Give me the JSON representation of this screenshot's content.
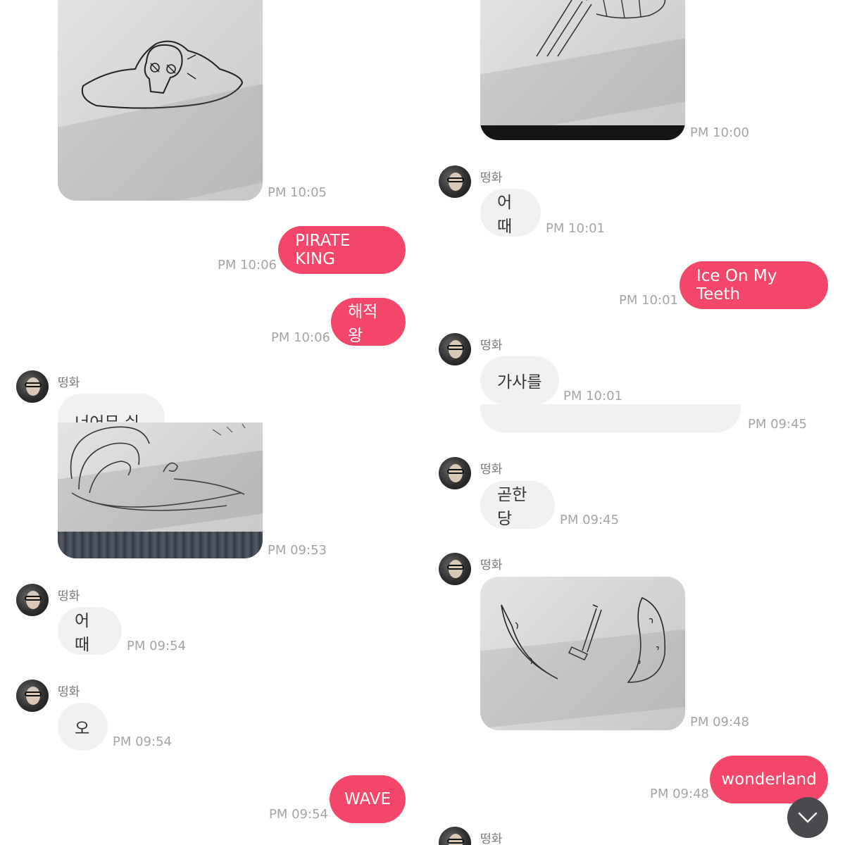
{
  "contact_name": "떵화",
  "colors": {
    "outgoing_bubble": "#f4456a",
    "incoming_bubble": "#f1f1f3",
    "timestamp": "#a5a5a5"
  },
  "left": {
    "photo_pirate_time": "PM 10:05",
    "out_pirate_king": {
      "text": "PIRATE KING",
      "time": "PM 10:06"
    },
    "out_haejeokwang": {
      "text": "해적왕",
      "time": "PM 10:06"
    },
    "in_too_easy": {
      "sender": "떵화",
      "text": "너어무 쉬다"
    },
    "photo_wave_time": "PM 09:53",
    "in_eottae": {
      "sender": "떵화",
      "text": "어 때",
      "time": "PM 09:54"
    },
    "in_o": {
      "sender": "떵화",
      "text": "오",
      "time": "PM 09:54"
    },
    "out_wave": {
      "text": "WAVE",
      "time": "PM 09:54"
    }
  },
  "right": {
    "photo_top_time": "PM 10:00",
    "in_eottae": {
      "sender": "떵화",
      "text": "어때",
      "time": "PM 10:01"
    },
    "out_ice": {
      "text": "Ice On My Teeth",
      "time": "PM 10:01"
    },
    "in_lyrics": {
      "sender": "떵화",
      "text": "가사를",
      "time": "PM 10:01"
    },
    "cut_time": "PM 09:45",
    "in_gonhandang": {
      "sender": "떵화",
      "text": "곧한당",
      "time": "PM 09:45"
    },
    "in_photo_sender": "떵화",
    "photo_sword_time": "PM 09:48",
    "out_wonderland": {
      "text": "wonderland",
      "time": "PM 09:48"
    },
    "last_sender": "떵화"
  },
  "icons": {
    "scroll_down": "chevron-down-icon",
    "avatar": "avatar"
  }
}
